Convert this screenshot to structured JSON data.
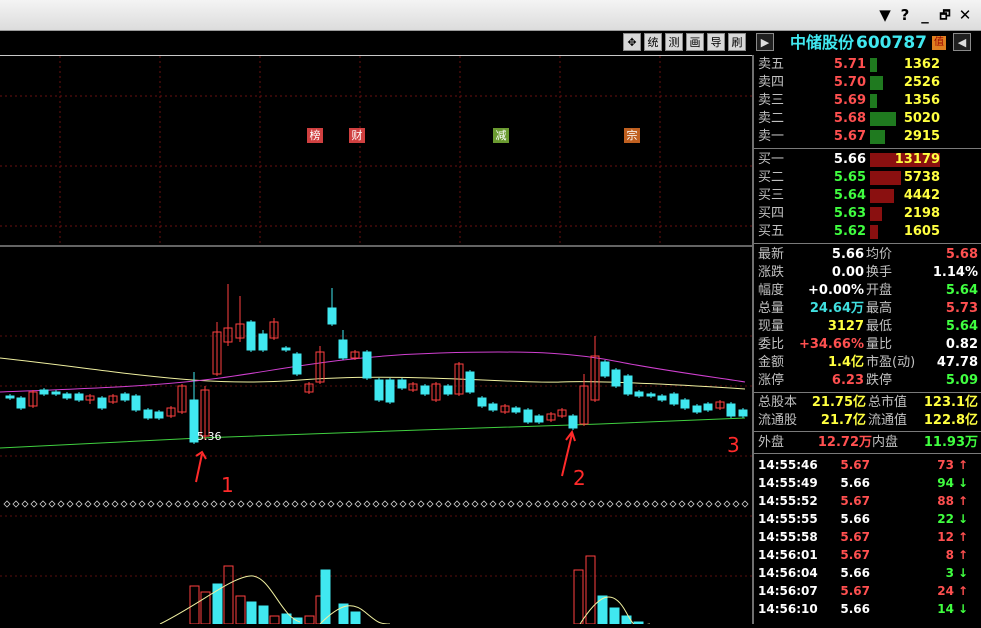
{
  "window": {
    "buttons": [
      "▼",
      "?",
      "_",
      "🗗",
      "✕"
    ]
  },
  "toolbar": {
    "buttons": [
      "✥",
      "统",
      "测",
      "画",
      "导",
      "刷",
      "▶"
    ]
  },
  "stock": {
    "name": "中储股份",
    "code": "600787",
    "badge": "值",
    "nav": "◀"
  },
  "markers": [
    {
      "label": "榜",
      "color": "#d04040"
    },
    {
      "label": "财",
      "color": "#d04040"
    },
    {
      "label": "减",
      "color": "#6a9a30"
    },
    {
      "label": "宗",
      "color": "#c06020"
    }
  ],
  "asks": [
    {
      "label": "卖五",
      "price": "5.71",
      "volume": "1362",
      "level": 0.27
    },
    {
      "label": "卖四",
      "price": "5.70",
      "volume": "2526",
      "level": 0.5
    },
    {
      "label": "卖三",
      "price": "5.69",
      "volume": "1356",
      "level": 0.27
    },
    {
      "label": "卖二",
      "price": "5.68",
      "volume": "5020",
      "level": 1.0
    },
    {
      "label": "卖一",
      "price": "5.67",
      "volume": "2915",
      "level": 0.58
    }
  ],
  "bids": [
    {
      "label": "买一",
      "price": "5.66",
      "volume": "13179",
      "level": 1.0
    },
    {
      "label": "买二",
      "price": "5.65",
      "volume": "5738",
      "level": 0.44
    },
    {
      "label": "买三",
      "price": "5.64",
      "volume": "4442",
      "level": 0.34
    },
    {
      "label": "买四",
      "price": "5.63",
      "volume": "2198",
      "level": 0.17
    },
    {
      "label": "买五",
      "price": "5.62",
      "volume": "1605",
      "level": 0.12
    }
  ],
  "stats": [
    {
      "l1": "最新",
      "v1": "5.66",
      "c1": "#ffffff",
      "l2": "均价",
      "v2": "5.68",
      "c2": "#ff5050"
    },
    {
      "l1": "涨跌",
      "v1": "0.00",
      "c1": "#ffffff",
      "l2": "换手",
      "v2": "1.14%",
      "c2": "#ffffff"
    },
    {
      "l1": "幅度",
      "v1": "+0.00%",
      "c1": "#ffffff",
      "l2": "开盘",
      "v2": "5.64",
      "c2": "#40ff40"
    },
    {
      "l1": "总量",
      "v1": "24.64万",
      "c1": "#40e0e0",
      "l2": "最高",
      "v2": "5.73",
      "c2": "#ff5050"
    },
    {
      "l1": "现量",
      "v1": "3127",
      "c1": "#ffff40",
      "l2": "最低",
      "v2": "5.64",
      "c2": "#40ff40"
    },
    {
      "l1": "委比",
      "v1": "+34.66%",
      "c1": "#ff5050",
      "l2": "量比",
      "v2": "0.82",
      "c2": "#ffffff"
    },
    {
      "l1": "金额",
      "v1": "1.4亿",
      "c1": "#ffff40",
      "l2": "市盈(动)",
      "v2": "47.78",
      "c2": "#ffffff"
    },
    {
      "l1": "涨停",
      "v1": "6.23",
      "c1": "#ff5050",
      "l2": "跌停",
      "v2": "5.09",
      "c2": "#40ff40"
    }
  ],
  "capital": [
    {
      "l1": "总股本",
      "v1": "21.75亿",
      "l2": "总市值",
      "v2": "123.1亿"
    },
    {
      "l1": "流通股",
      "v1": "21.7亿",
      "l2": "流通值",
      "v2": "122.8亿"
    }
  ],
  "flow": {
    "l1": "外盘",
    "v1": "12.72万",
    "l2": "内盘",
    "v2": "11.93万"
  },
  "ticks": [
    {
      "time": "14:55:46",
      "price": "5.67",
      "vol": "73",
      "dir": "↑"
    },
    {
      "time": "14:55:49",
      "price": "5.66",
      "vol": "94",
      "dir": "↓"
    },
    {
      "time": "14:55:52",
      "price": "5.67",
      "vol": "88",
      "dir": "↑"
    },
    {
      "time": "14:55:55",
      "price": "5.66",
      "vol": "22",
      "dir": "↓"
    },
    {
      "time": "14:55:58",
      "price": "5.67",
      "vol": "12",
      "dir": "↑"
    },
    {
      "time": "14:56:01",
      "price": "5.67",
      "vol": "8",
      "dir": "↑"
    },
    {
      "time": "14:56:04",
      "price": "5.66",
      "vol": "3",
      "dir": "↓"
    },
    {
      "time": "14:56:07",
      "price": "5.67",
      "vol": "24",
      "dir": "↑"
    },
    {
      "time": "14:56:10",
      "price": "5.66",
      "vol": "14",
      "dir": "↓"
    }
  ],
  "chart": {
    "low_label": "5.36",
    "annotations": [
      "1",
      "2",
      "3"
    ]
  },
  "colors": {
    "up": "#ff4040",
    "down": "#40e8f0",
    "ma_short": "#f0f0a0",
    "ma_mid": "#d040d0",
    "ma_long": "#40d040"
  }
}
